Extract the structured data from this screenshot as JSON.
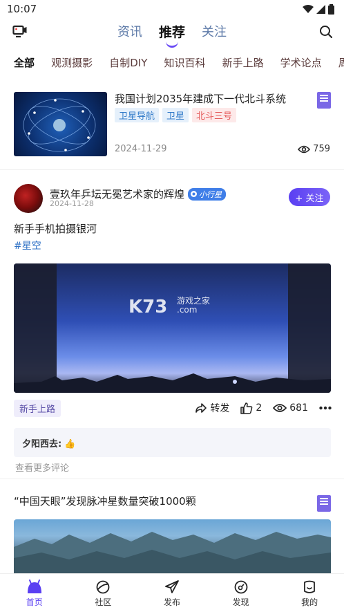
{
  "status": {
    "time": "10:07"
  },
  "header": {
    "tabs": [
      {
        "label": "资讯"
      },
      {
        "label": "推荐"
      },
      {
        "label": "关注"
      }
    ],
    "active_tab": "推荐"
  },
  "categories": [
    "全部",
    "观测摄影",
    "自制DIY",
    "知识百科",
    "新手上路",
    "学术论点",
    "周边"
  ],
  "article1": {
    "title": "我国计划2035年建成下一代北斗系统",
    "tags": [
      "卫星导航",
      "卫星",
      "北斗三号"
    ],
    "date": "2024-11-29",
    "views": "759"
  },
  "post": {
    "author": "壹玖年乒坛无冕艺术家的辉煌",
    "badge": "小行星",
    "date": "2024-11-28",
    "follow_label": "+ 关注",
    "text": "新手手机拍摄银河",
    "topic": "#星空",
    "watermark_main": "K73",
    "watermark_sub_1": "游戏之家",
    "watermark_sub_2": ".com",
    "chip": "新手上路",
    "share_label": "转发",
    "likes": "2",
    "views": "681",
    "comment_user": "夕阳西去:",
    "comment_text": "👍",
    "more_comments": "查看更多评论"
  },
  "article3": {
    "title": "“中国天眼”发现脉冲星数量突破1000颗"
  },
  "bottom_nav": [
    {
      "label": "首页"
    },
    {
      "label": "社区"
    },
    {
      "label": "发布"
    },
    {
      "label": "发现"
    },
    {
      "label": "我的"
    }
  ],
  "colors": {
    "accent": "#5a3ff2",
    "tag_blue": "#2f79c8",
    "tag_red": "#e45a5a"
  }
}
